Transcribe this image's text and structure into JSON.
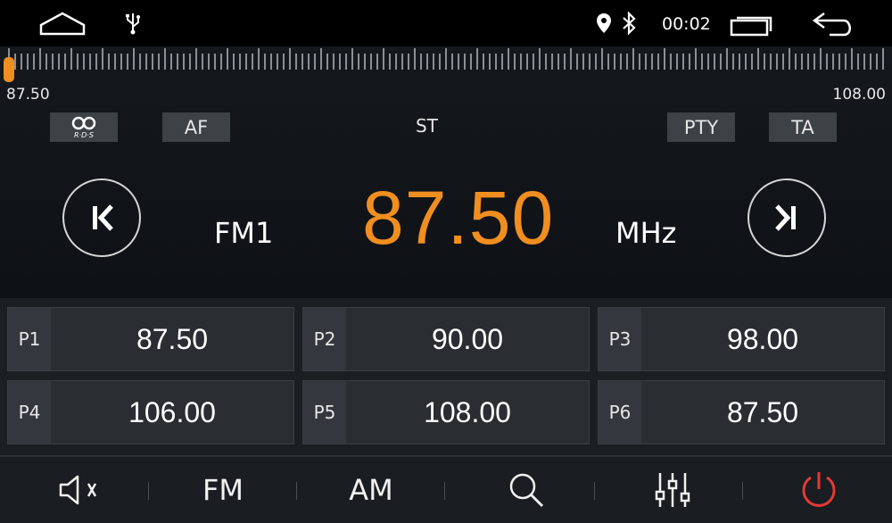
{
  "statusbar": {
    "icons": [
      "home-icon",
      "usb-icon",
      "location-icon",
      "bluetooth-icon",
      "recent-apps-icon",
      "back-icon"
    ],
    "time": "00:02"
  },
  "scale": {
    "min_label": "87.50",
    "max_label": "108.00",
    "pointer_value": 87.5,
    "min": 87.5,
    "max": 108.0,
    "accent": "#f08e1f"
  },
  "tags": {
    "rds": "R·D·S",
    "af": "AF",
    "st": "ST",
    "pty": "PTY",
    "ta": "TA"
  },
  "tuner": {
    "band": "FM1",
    "frequency": "87.50",
    "unit": "MHz",
    "frequency_color": "#f08e1f"
  },
  "presets": [
    {
      "label": "P1",
      "freq": "87.50"
    },
    {
      "label": "P2",
      "freq": "90.00"
    },
    {
      "label": "P3",
      "freq": "98.00"
    },
    {
      "label": "P4",
      "freq": "106.00"
    },
    {
      "label": "P5",
      "freq": "108.00"
    },
    {
      "label": "P6",
      "freq": "87.50"
    }
  ],
  "bottombar": {
    "fm_label": "FM",
    "am_label": "AM",
    "icons": [
      "mute-icon",
      "search-icon",
      "equalizer-icon",
      "power-icon"
    ],
    "power_color": "#e53935"
  }
}
